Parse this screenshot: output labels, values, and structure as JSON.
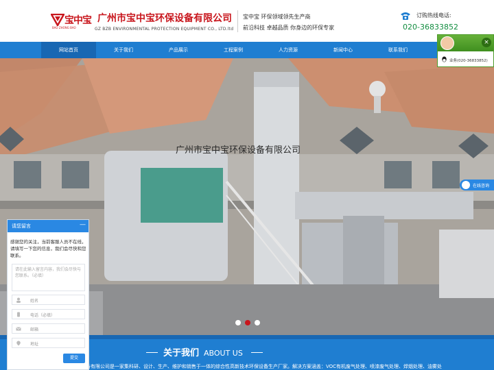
{
  "header": {
    "logo_text": "宝中宝",
    "logo_sub": "BAO ZHONG BAO",
    "company_name": "广州市宝中宝环保设备有限公司",
    "company_en": "GZ BZB ENVIRONMENTAL PROTECTION EQUIPMENT CO., LTD.ltd",
    "slogan_1": "宝中宝 环保领域领先生产商",
    "slogan_2": "前沿科技 卓越品质 你身边的环保专家",
    "hotline_label": "订购热线电话:",
    "hotline_number": "020-36833852"
  },
  "nav": {
    "items": [
      {
        "label": "网站首页"
      },
      {
        "label": "关于我们"
      },
      {
        "label": "产品展示"
      },
      {
        "label": "工程案例"
      },
      {
        "label": "人力资源"
      },
      {
        "label": "新闻中心"
      },
      {
        "label": "联系我们"
      }
    ],
    "active_index": 0
  },
  "banner": {
    "caption": "广州市宝中宝环保设备有限公司",
    "slide_count": 3,
    "active_slide": 2
  },
  "about": {
    "title": "关于我们",
    "title_en": "ABOUT US",
    "intro": "广州市宝中宝环保设备有限公司是一家集科研、设计、生产、维护和销售于一体的综合性高新技术环保设备生产厂家。解决方案涵盖：VOC有机废气处理、喷漆废气处理、焊烟处理、油雾处"
  },
  "chat": {
    "title": "请您留言",
    "minimize": "—",
    "message": "感谢您的关注，当前客服人员不在线，请填写一下您的信息，我们会尽快和您联系。",
    "textarea_placeholder": "请在此输入留言内容，我们会尽快与您联系。（必填）",
    "fields": [
      {
        "placeholder": "姓名",
        "icon": "person-icon"
      },
      {
        "placeholder": "电话（必填）",
        "icon": "phone-icon"
      },
      {
        "placeholder": "邮箱",
        "icon": "mail-icon"
      },
      {
        "placeholder": "地址",
        "icon": "location-icon"
      }
    ],
    "submit_label": "提交"
  },
  "float_service": {
    "label": "业务(020-36833852)",
    "close": "×",
    "online_label": "在线咨询"
  },
  "colors": {
    "brand_red": "#c8161d",
    "nav_blue": "#1f7ed1",
    "hotline_green": "#118c3f"
  }
}
